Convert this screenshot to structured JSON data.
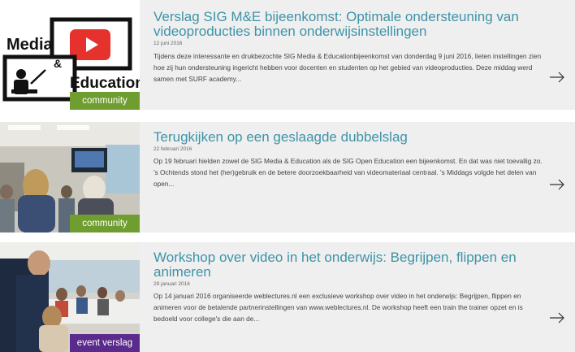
{
  "articles": [
    {
      "title": "Verslag SIG M&E bijeenkomst: Optimale ondersteuning van videoproducties binnen onderwijsinstellingen",
      "date": "12 juni 2016",
      "excerpt": "Tijdens deze interessante en drukbezochte SIG Media & Educationbijeenkomst van donderdag 9 juni 2016, lieten instellingen zien hoe zij hun ondersteuning ingericht hebben voor docenten en studenten op het gebied van videoproducties. Deze middag werd samen met SURF academy...",
      "tag": "community",
      "tag_color": "#6f9d2f",
      "logo_text_top": "Media",
      "logo_text_amp": "&",
      "logo_text_bottom": "Education"
    },
    {
      "title": "Terugkijken op een geslaagde dubbelslag",
      "date": "22 februari 2016",
      "excerpt": "Op 19 februari hielden zowel de SIG Media & Education als de SIG Open Education een bijeenkomst. En dat was niet toevallig zo. 's Ochtends stond het (her)gebruik en de betere doorzoekbaarheid van videomateriaal centraal. 's Middags volgde het delen van open...",
      "tag": "community",
      "tag_color": "#6f9d2f"
    },
    {
      "title": "Workshop over video in het onderwijs: Begrijpen, flippen en animeren",
      "date": "29 januari 2016",
      "excerpt": "Op 14 januari 2016 organiseerde weblectures.nl een exclusieve workshop over video in het onderwijs: Begrijpen, flippen en animeren voor de betalende partnerinstellingen van www.weblectures.nl. De workshop heeft een train the trainer opzet en is bedoeld voor college's die aan de...",
      "tag": "event verslag",
      "tag_color": "#5a2a8c"
    }
  ],
  "colors": {
    "card_bg": "#efefef",
    "title": "#3d93a8",
    "logo_red": "#e5322d"
  },
  "icons": {
    "more": "arrow-right-icon"
  }
}
